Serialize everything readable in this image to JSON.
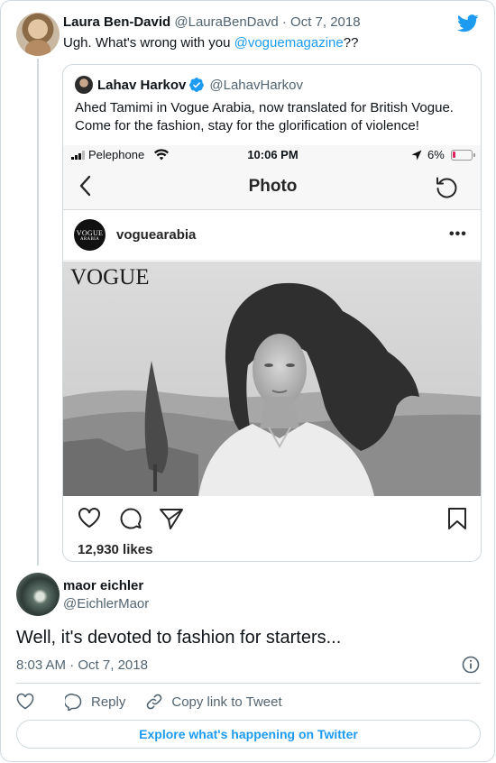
{
  "parent_tweet": {
    "author_name": "Laura Ben-David",
    "author_handle": "@LauraBenDavd",
    "separator": "·",
    "date": "Oct 7, 2018",
    "text_before_mention": "Ugh. What's wrong with you ",
    "mention": "@voguemagazine",
    "text_after_mention": "??"
  },
  "quoted_tweet": {
    "author_name": "Lahav Harkov",
    "verified": true,
    "author_handle": "@LahavHarkov",
    "text_line1": "Ahed Tamimi in Vogue Arabia, now translated for British Vogue.",
    "text_line2": "Come for the fashion, stay for the glorification of violence!",
    "embedded_screenshot": {
      "status_bar": {
        "carrier": "Pelephone",
        "time": "10:06 PM",
        "battery": "6%",
        "battery_color": "#e0245e"
      },
      "nav_title": "Photo",
      "post_username": "voguearabia",
      "avatar_text_top": "VOGUE",
      "avatar_text_bottom": "ARABIA",
      "more_label": "•••",
      "photo_watermark": "VOGUE",
      "likes": "12,930 likes"
    }
  },
  "reply_tweet": {
    "author_name": "maor eichler",
    "author_handle": "@EichlerMaor",
    "text": "Well, it's devoted to fashion for starters...",
    "time": "8:03 AM",
    "separator": "·",
    "date": "Oct 7, 2018"
  },
  "actions": {
    "reply_label": "Reply",
    "copy_label": "Copy link to Tweet"
  },
  "explore_label": "Explore what's happening on Twitter",
  "colors": {
    "twitter_blue": "#1d9bf0",
    "secondary_text": "#536471",
    "border": "#cfd9de"
  }
}
